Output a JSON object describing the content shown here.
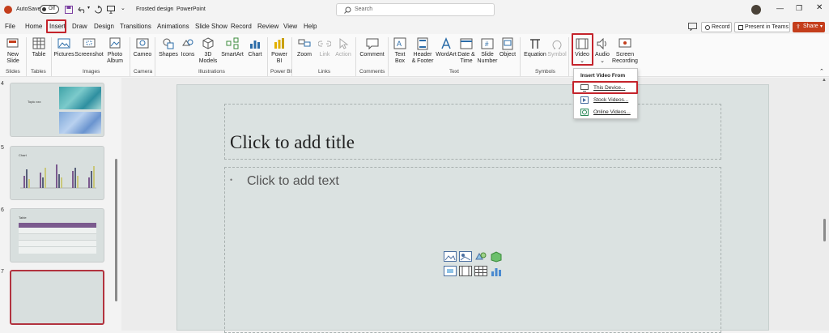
{
  "titlebar": {
    "autosave_label": "AutoSave",
    "autosave_state": "Off",
    "doc_name": "Frosted design",
    "separator": "-",
    "app_name": "PowerPoint",
    "search_placeholder": "Search",
    "window_controls": [
      "minimize-icon",
      "restore-icon",
      "close-icon"
    ]
  },
  "menu": {
    "tabs": [
      "File",
      "Home",
      "Insert",
      "Draw",
      "Design",
      "Transitions",
      "Animations",
      "Slide Show",
      "Record",
      "Review",
      "View",
      "Help"
    ],
    "active_tab": "Insert",
    "record_label": "Record",
    "present_label": "Present in Teams",
    "share_label": "Share"
  },
  "ribbon": {
    "slides": {
      "new_slide_1": "New",
      "new_slide_2": "Slide",
      "group": "Slides"
    },
    "tables": {
      "table": "Table",
      "group": "Tables"
    },
    "images": {
      "pictures": "Pictures",
      "screenshot": "Screenshot",
      "photo_1": "Photo",
      "photo_2": "Album",
      "group": "Images"
    },
    "camera": {
      "cameo": "Cameo",
      "group": "Camera"
    },
    "illustrations": {
      "shapes": "Shapes",
      "icons": "Icons",
      "models_1": "3D",
      "models_2": "Models",
      "smartart": "SmartArt",
      "chart": "Chart",
      "group": "Illustrations"
    },
    "powerbi": {
      "label_1": "Power",
      "label_2": "BI",
      "group": "Power BI"
    },
    "links": {
      "zoom": "Zoom",
      "link": "Link",
      "action": "Action",
      "group": "Links"
    },
    "comments": {
      "comment": "Comment",
      "group": "Comments"
    },
    "text": {
      "textbox_1": "Text",
      "textbox_2": "Box",
      "header_1": "Header",
      "header_2": "& Footer",
      "wordart": "WordArt",
      "date_1": "Date &",
      "date_2": "Time",
      "slidenum_1": "Slide",
      "slidenum_2": "Number",
      "object": "Object",
      "group": "Text"
    },
    "symbols": {
      "equation": "Equation",
      "symbol": "Symbol",
      "group": "Symbols"
    },
    "media": {
      "video": "Video",
      "audio": "Audio",
      "screenrec_1": "Screen",
      "screenrec_2": "Recording"
    }
  },
  "dropdown": {
    "header": "Insert Video From",
    "items": [
      "This Device...",
      "Stock Videos...",
      "Online Videos..."
    ]
  },
  "thumbnails": [
    {
      "number": "4",
      "title": "Topic xxx"
    },
    {
      "number": "5",
      "title": "Chart"
    },
    {
      "number": "6",
      "title": "Table"
    },
    {
      "number": "7",
      "title": ""
    }
  ],
  "slide": {
    "title_placeholder": "Click to add title",
    "body_placeholder": "Click to add text",
    "bullet": "•"
  },
  "colors": {
    "accent_red": "#c4232b",
    "share_orange": "#c43e1c",
    "slide_bg": "#dbe2e1",
    "table_header": "#7b5a8e"
  }
}
